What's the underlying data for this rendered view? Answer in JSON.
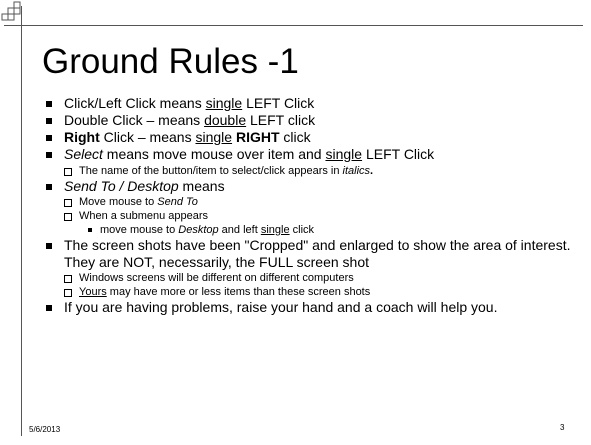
{
  "title": "Ground Rules -1",
  "bullets": {
    "b1": {
      "a": "Click/Left Click means ",
      "u": "single",
      "b": " LEFT Click"
    },
    "b2": {
      "a": "Double Click – means ",
      "u": "double",
      "b": " LEFT click"
    },
    "b3": {
      "bold": "Right",
      "a": " Click – means ",
      "u": "single",
      "bold2": "RIGHT",
      "b": " click"
    },
    "b4": {
      "i": "Select",
      "a": " means move mouse over item and ",
      "u": "single",
      "b": " LEFT Click"
    },
    "b4s1": {
      "a": "The name of the button/item to select/click appears in ",
      "i": "italics",
      "b": "."
    },
    "b5": {
      "i": "Send To / Desktop",
      "a": " means"
    },
    "b5s1": {
      "a": "Move mouse to ",
      "i": "Send To"
    },
    "b5s2": {
      "a": "When a submenu appears"
    },
    "b5s2s1": {
      "a": "move mouse to ",
      "i": "Desktop",
      "b": " and left ",
      "u": "single",
      "c": " click"
    },
    "b6": {
      "a": "The screen shots have been \"Cropped\" and enlarged to show the area of interest. They are NOT, necessarily, the FULL screen shot"
    },
    "b6s1": {
      "a": "Windows screens will be different on different computers"
    },
    "b6s2": {
      "u": "Yours",
      "a": " may have more or less items than these screen shots"
    },
    "b7": {
      "a": "If you are having problems, raise your hand and a coach will help you."
    }
  },
  "footer": {
    "date": "5/6/2013",
    "page": "3"
  }
}
